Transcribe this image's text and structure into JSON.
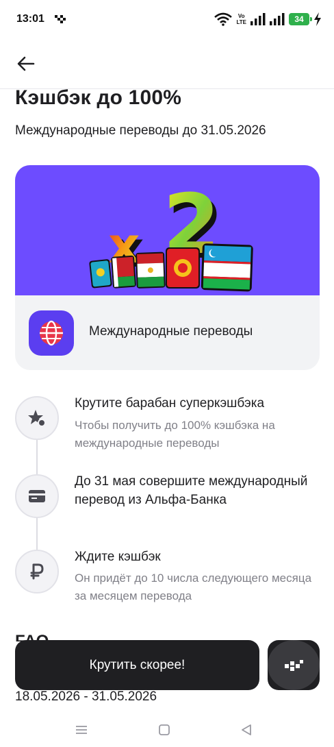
{
  "status_bar": {
    "time": "13:01",
    "network_top": "Vo",
    "network_bottom": "LTE",
    "battery": "34"
  },
  "header": {
    "back_icon": "arrow-left-icon"
  },
  "page": {
    "title": "Кэшбэк до 100%",
    "subtitle": "Международные переводы до 31.05.2026"
  },
  "promo": {
    "banner_text": "x2",
    "banner_color": "#6d4cff",
    "label": "Международные переводы",
    "icon": "globe-icon"
  },
  "steps": [
    {
      "icon": "star-icon",
      "title": "Крутите барабан суперкэшбэка",
      "description": "Чтобы получить до 100% кэшбэка на международные переводы"
    },
    {
      "icon": "card-icon",
      "title": "До 31 мая совершите международный перевод из Альфа-Банка",
      "description": ""
    },
    {
      "icon": "ruble-icon",
      "title": "Ждите кэшбэк",
      "description": "Он придёт до 10 числа следующего месяца за месяцем перевода"
    }
  ],
  "faq": {
    "heading": "FAQ"
  },
  "dates": {
    "range": "18.05.2026 - 31.05.2026"
  },
  "cta": {
    "label": "Крутить скорее!"
  },
  "nav": {
    "menu_icon": "menu-icon",
    "home_icon": "home-square-icon",
    "back_icon": "back-triangle-icon"
  }
}
